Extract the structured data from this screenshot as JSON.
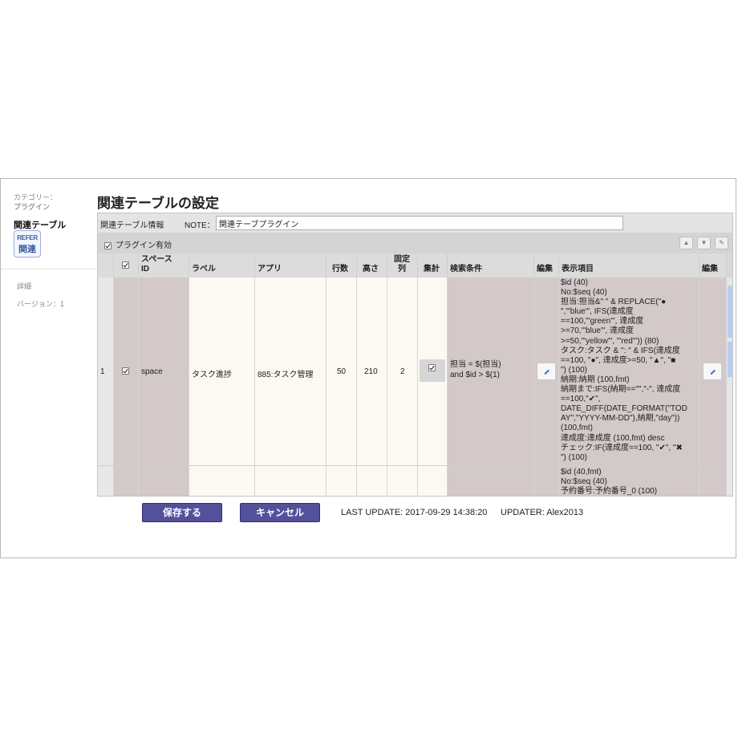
{
  "sidebar": {
    "category_label": "カテゴリー：",
    "category_value": "プラグイン",
    "title": "関連テーブル",
    "logo_line1": "REFER",
    "logo_line2": "関連",
    "detail_link": "詳細",
    "version": "バージョン：1"
  },
  "page": {
    "title": "関連テーブルの設定"
  },
  "info": {
    "label": "関連テーブル情報",
    "note_label": "NOTE：",
    "note_value": "関連テーブプラグイン"
  },
  "plugin": {
    "enabled_label": "プラグイン有効",
    "enabled": true
  },
  "toolbar": {
    "move_up_icon": "arrow-up-icon",
    "move_down_icon": "arrow-down-icon",
    "settings_icon": "wrench-icon"
  },
  "table": {
    "headers": {
      "space_id": "スペース\nID",
      "label": "ラベル",
      "app": "アプリ",
      "rows": "行数",
      "height": "高さ",
      "fixed": "固定\n列",
      "aggregate": "集計",
      "search": "検索条件",
      "edit": "編集",
      "display": "表示項目",
      "edit2": "編集"
    },
    "rows": [
      {
        "num": "1",
        "checked": true,
        "space_id": "space",
        "label": "タスク進捗",
        "app": "885:タスク管理",
        "rows": "50",
        "height": "210",
        "fixed": "2",
        "aggregate": true,
        "search": "担当 = $(担当)\nand $id > $(1)",
        "display": "$id (40)\nNo:$seq (40)\n担当:担当&\" \" & REPLACE(\"●\n\",\"'blue'\", IFS(達成度\n==100,\"'green'\", 達成度\n>=70,\"'blue'\", 達成度\n>=50,\"'yellow'\", \"'red'\")) (80)\nタスク:タスク & \": \" & IFS(達成度\n==100, \"●\", 達成度>=50, \"▲\", \"■\n\") (100)\n納期:納期 (100,fmt)\n納期まで:IFS(納期==\"\",\"-\", 達成度\n==100,\"✔\",\nDATE_DIFF(DATE_FORMAT(\"TOD\nAY\",\"YYYY-MM-DD\"),納期,\"day\"))\n(100,fmt)\n達成度:達成度 (100,fmt) desc\nチェック:IF(達成度==100, \"✔\", \"✖\n\") (100)"
      },
      {
        "display": "$id (40,fmt)\nNo:$seq (40)\n予約番号:予約番号_0 (100)"
      }
    ]
  },
  "footer": {
    "save_label": "保存する",
    "cancel_label": "キャンセル",
    "last_update": "LAST UPDATE: 2017-09-29 14:38:20",
    "updater": "UPDATER: Alex2013"
  },
  "colors": {
    "button": "#54519c",
    "panel": "#d8d8d8",
    "taupe": "#d3c9c9",
    "cream": "#fbf9f2"
  }
}
